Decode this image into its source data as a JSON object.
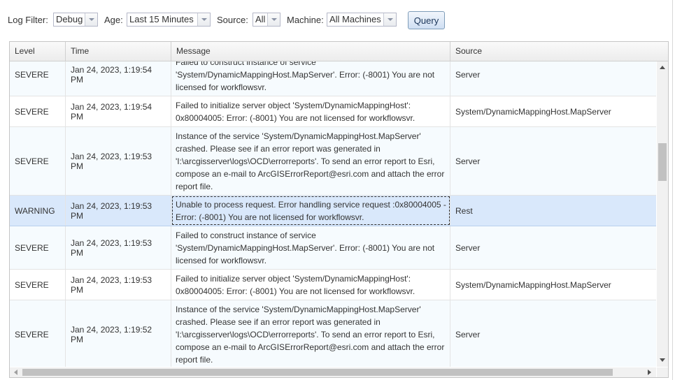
{
  "toolbar": {
    "log_filter_label": "Log Filter:",
    "log_filter_value": "Debug",
    "age_label": "Age:",
    "age_value": "Last 15 Minutes",
    "source_label": "Source:",
    "source_value": "All",
    "machine_label": "Machine:",
    "machine_value": "All Machines",
    "query_label": "Query"
  },
  "grid": {
    "columns": [
      "Level",
      "Time",
      "Message",
      "Source"
    ],
    "rows": [
      {
        "level": "SEVERE",
        "time": "Jan 24, 2023, 1:19:54 PM",
        "message": [
          "Failed to construct instance of service",
          "'System/DynamicMappingHost.MapServer'. Error: (-8001) You are not",
          "licensed for workflowsvr."
        ],
        "source": "Server"
      },
      {
        "level": "SEVERE",
        "time": "Jan 24, 2023, 1:19:54 PM",
        "message": [
          "Failed to initialize server object 'System/DynamicMappingHost':",
          "0x80004005: Error: (-8001) You are not licensed for workflowsvr."
        ],
        "source": "System/DynamicMappingHost.MapServer"
      },
      {
        "level": "SEVERE",
        "time": "Jan 24, 2023, 1:19:53 PM",
        "message": [
          "Instance of the service 'System/DynamicMappingHost.MapServer'",
          "crashed. Please see if an error report was generated in",
          "'I:\\arcgisserver\\logs\\OCD\\errorreports'. To send an error report to Esri,",
          "compose an e-mail to ArcGISErrorReport@esri.com and attach the error",
          "report file."
        ],
        "source": "Server"
      },
      {
        "level": "WARNING",
        "time": "Jan 24, 2023, 1:19:53 PM",
        "message": [
          "Unable to process request. Error handling service request :0x80004005 -",
          "Error: (-8001) You are not licensed for workflowsvr."
        ],
        "source": "Rest"
      },
      {
        "level": "SEVERE",
        "time": "Jan 24, 2023, 1:19:53 PM",
        "message": [
          "Failed to construct instance of service",
          "'System/DynamicMappingHost.MapServer'. Error: (-8001) You are not",
          "licensed for workflowsvr."
        ],
        "source": "Server"
      },
      {
        "level": "SEVERE",
        "time": "Jan 24, 2023, 1:19:53 PM",
        "message": [
          "Failed to initialize server object 'System/DynamicMappingHost':",
          "0x80004005: Error: (-8001) You are not licensed for workflowsvr."
        ],
        "source": "System/DynamicMappingHost.MapServer"
      },
      {
        "level": "SEVERE",
        "time": "Jan 24, 2023, 1:19:52 PM",
        "message": [
          "Instance of the service 'System/DynamicMappingHost.MapServer'",
          "crashed. Please see if an error report was generated in",
          "'I:\\arcgisserver\\logs\\OCD\\errorreports'. To send an error report to Esri,",
          "compose an e-mail to ArcGISErrorReport@esri.com and attach the error",
          "report file."
        ],
        "source": "Server"
      }
    ]
  }
}
